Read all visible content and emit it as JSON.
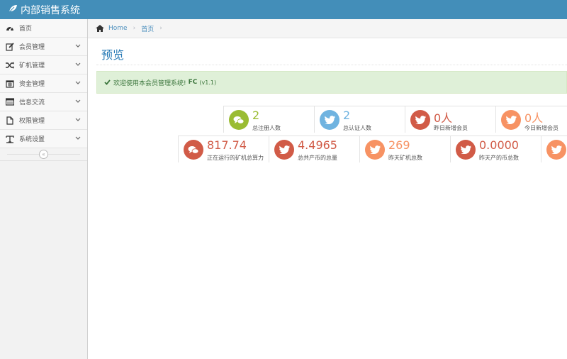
{
  "app": {
    "title": "内部销售系统"
  },
  "colors": {
    "navbar": "#438eb9",
    "green": "#9abc32",
    "blue": "#6fb3e0",
    "red": "#d15b47",
    "orange": "#f79263"
  },
  "sidebar": {
    "items": [
      {
        "label": "首页",
        "icon": "dashboard-icon",
        "has_children": false
      },
      {
        "label": "会员管理",
        "icon": "edit-icon",
        "has_children": true
      },
      {
        "label": "矿机管理",
        "icon": "random-icon",
        "has_children": true
      },
      {
        "label": "资金管理",
        "icon": "calendar-icon",
        "has_children": true
      },
      {
        "label": "信息交流",
        "icon": "list-icon",
        "has_children": true
      },
      {
        "label": "权限管理",
        "icon": "file-icon",
        "has_children": true
      },
      {
        "label": "系统设置",
        "icon": "text-icon",
        "has_children": true
      }
    ],
    "collapse_symbol": "«"
  },
  "breadcrumb": {
    "home": "Home",
    "current": "首页"
  },
  "page": {
    "title": "预览"
  },
  "alert": {
    "message": "欢迎使用本会员管理系统!",
    "brand": "FC",
    "version": "(v1.1)"
  },
  "stats": {
    "row1": [
      {
        "value": "2",
        "label": "总注册人数",
        "icon": "comments-icon",
        "color": "green"
      },
      {
        "value": "2",
        "label": "总认证人数",
        "icon": "twitter-icon",
        "color": "blue"
      },
      {
        "value": "0人",
        "label": "昨日新增会员",
        "icon": "twitter-icon",
        "color": "red"
      },
      {
        "value": "0人",
        "label": "今日新增会员",
        "icon": "twitter-icon",
        "color": "orange"
      }
    ],
    "row2": [
      {
        "value": "817.74",
        "label": "正在运行的矿机总算力",
        "icon": "comments-icon",
        "color": "red"
      },
      {
        "value": "4.4965",
        "label": "总共产币的总量",
        "icon": "twitter-icon",
        "color": "red"
      },
      {
        "value": "269",
        "label": "昨天矿机总数",
        "icon": "twitter-icon",
        "color": "orange"
      },
      {
        "value": "0.0000",
        "label": "昨天产的币总数",
        "icon": "twitter-icon",
        "color": "red"
      },
      {
        "value": "",
        "label": "",
        "icon": "twitter-icon",
        "color": "orange"
      }
    ]
  }
}
